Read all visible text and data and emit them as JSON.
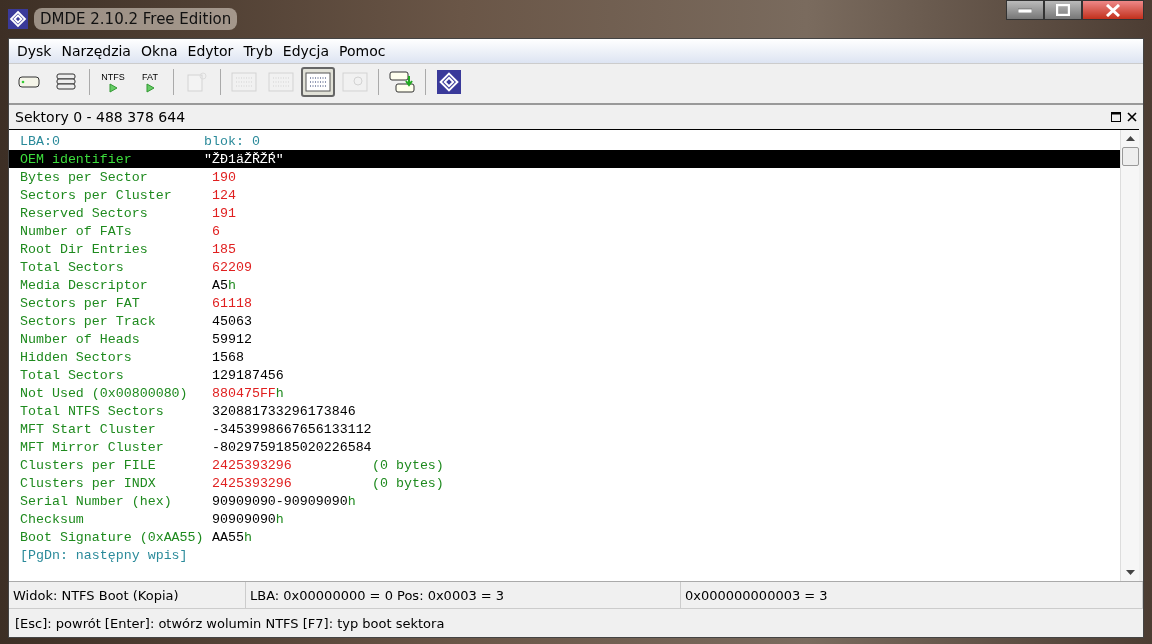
{
  "window": {
    "title": "DMDE 2.10.2 Free Edition"
  },
  "menu": [
    {
      "label": "Dysk"
    },
    {
      "label": "Narzędzia"
    },
    {
      "label": "Okna"
    },
    {
      "label": "Edytor"
    },
    {
      "label": "Tryb"
    },
    {
      "label": "Edycja"
    },
    {
      "label": "Pomoc"
    }
  ],
  "toolbar": [
    {
      "kind": "disk",
      "disabled": false,
      "selected": false
    },
    {
      "kind": "disks",
      "disabled": false,
      "selected": false
    },
    {
      "kind": "sep"
    },
    {
      "kind": "run",
      "label": "NTFS",
      "disabled": false,
      "selected": false
    },
    {
      "kind": "run",
      "label": "FAT",
      "disabled": false,
      "selected": false
    },
    {
      "kind": "sep"
    },
    {
      "kind": "newdoc",
      "disabled": true,
      "selected": false
    },
    {
      "kind": "sep"
    },
    {
      "kind": "tree",
      "disabled": true,
      "selected": false
    },
    {
      "kind": "list",
      "disabled": true,
      "selected": false
    },
    {
      "kind": "grid",
      "disabled": false,
      "selected": true
    },
    {
      "kind": "find",
      "disabled": true,
      "selected": false
    },
    {
      "kind": "sep"
    },
    {
      "kind": "copy",
      "disabled": false,
      "selected": false
    },
    {
      "kind": "sep"
    },
    {
      "kind": "logo",
      "disabled": false,
      "selected": false
    }
  ],
  "panel": {
    "title": "Sektory 0 - 488 378 644"
  },
  "rows": [
    {
      "kind": "header",
      "label": "LBA:0",
      "value": "blok: 0",
      "selected": false
    },
    {
      "kind": "field",
      "label": "OEM identifier",
      "value": "\"ŽĐ1äŽŘŽŔ\"",
      "quoted": true,
      "invalid": false,
      "selected": true
    },
    {
      "kind": "field",
      "label": "Bytes per Sector",
      "value": "190",
      "invalid": true,
      "selected": false
    },
    {
      "kind": "field",
      "label": "Sectors per Cluster",
      "value": "124",
      "invalid": true,
      "selected": false
    },
    {
      "kind": "field",
      "label": "Reserved Sectors",
      "value": "191",
      "invalid": true,
      "selected": false
    },
    {
      "kind": "field",
      "label": "Number of FATs",
      "value": "6",
      "invalid": true,
      "selected": false
    },
    {
      "kind": "field",
      "label": "Root Dir Entries",
      "value": "185",
      "invalid": true,
      "selected": false
    },
    {
      "kind": "field",
      "label": "Total Sectors",
      "value": "62209",
      "invalid": true,
      "selected": false
    },
    {
      "kind": "field",
      "label": "Media Descriptor",
      "value": "A5",
      "suffix": "h",
      "invalid": false,
      "selected": false
    },
    {
      "kind": "field",
      "label": "Sectors per FAT",
      "value": "61118",
      "invalid": true,
      "selected": false
    },
    {
      "kind": "field",
      "label": "Sectors per Track",
      "value": "45063",
      "invalid": false,
      "selected": false
    },
    {
      "kind": "field",
      "label": "Number of Heads",
      "value": "59912",
      "invalid": false,
      "selected": false
    },
    {
      "kind": "field",
      "label": "Hidden Sectors",
      "value": "1568",
      "invalid": false,
      "selected": false
    },
    {
      "kind": "field",
      "label": "Total Sectors",
      "value": "129187456",
      "invalid": false,
      "selected": false
    },
    {
      "kind": "field",
      "label": "Not Used (0x00800080)",
      "value": "880475FF",
      "suffix": "h",
      "invalid": true,
      "selected": false
    },
    {
      "kind": "field",
      "label": "Total NTFS Sectors",
      "value": "320881733296173846",
      "invalid": false,
      "selected": false
    },
    {
      "kind": "field",
      "label": "MFT Start Cluster",
      "value": "-3453998667656133112",
      "invalid": false,
      "selected": false
    },
    {
      "kind": "field",
      "label": "MFT Mirror Cluster",
      "value": "-8029759185020226584",
      "invalid": false,
      "selected": false
    },
    {
      "kind": "field",
      "label": "Clusters per FILE",
      "value": "2425393296",
      "note": "(0 bytes)",
      "invalid": true,
      "selected": false
    },
    {
      "kind": "field",
      "label": "Clusters per INDX",
      "value": "2425393296",
      "note": "(0 bytes)",
      "invalid": true,
      "selected": false
    },
    {
      "kind": "field",
      "label": "Serial Number (hex)",
      "value": "90909090-90909090",
      "suffix": "h",
      "invalid": false,
      "selected": false
    },
    {
      "kind": "field",
      "label": "Checksum",
      "value": "90909090",
      "suffix": "h",
      "invalid": false,
      "selected": false
    },
    {
      "kind": "field",
      "label": "Boot Signature (0xAA55)",
      "value": "AA55",
      "suffix": "h",
      "invalid": false,
      "selected": false
    },
    {
      "kind": "hint",
      "label": "[PgDn: następny wpis]",
      "selected": false
    }
  ],
  "status_bar": [
    "Widok: NTFS Boot (Kopia)",
    "LBA: 0x00000000 = 0  Pos: 0x0003 = 3",
    "0x000000000003 = 3"
  ],
  "hint_bar": "[Esc]: powrót  [Enter]: otwórz wolumin NTFS  [F7]: typ boot sektora"
}
